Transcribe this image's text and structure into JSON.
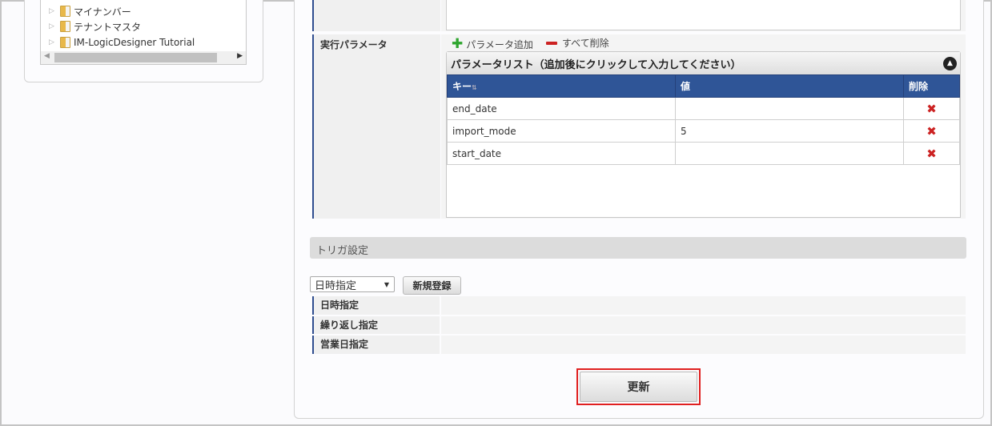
{
  "tree": {
    "items": [
      "マイナンバー",
      "テナントマスタ",
      "IM-LogicDesigner Tutorial"
    ]
  },
  "form": {
    "exec_params_label": "実行パラメータ",
    "add_param": "パラメータ追加",
    "delete_all": "すべて削除",
    "param_list_title": "パラメータリスト（追加後にクリックして入力してください）",
    "columns": {
      "key": "キー",
      "value": "値",
      "delete": "削除"
    },
    "rows": [
      {
        "key": "end_date",
        "value": ""
      },
      {
        "key": "import_mode",
        "value": "5"
      },
      {
        "key": "start_date",
        "value": ""
      }
    ]
  },
  "trigger": {
    "title": "トリガ設定",
    "select_value": "日時指定",
    "new_button": "新規登録",
    "rows": [
      "日時指定",
      "繰り返し指定",
      "営業日指定"
    ]
  },
  "update_button": "更新",
  "colors": {
    "header_blue": "#2f5597",
    "highlight_red": "#e02020",
    "add_green": "#2ea52e",
    "delete_red": "#cc2222"
  }
}
